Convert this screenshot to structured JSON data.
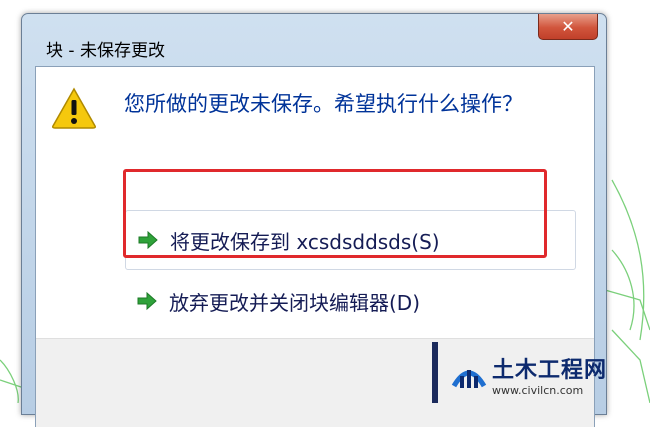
{
  "window": {
    "title": "块 - 未保存更改",
    "close_glyph": "✕"
  },
  "dialog": {
    "question": "您所做的更改未保存。希望执行什么操作？",
    "options": [
      {
        "label": "将更改保存到 xcsdsddsds(S)",
        "icon": "green-arrow-icon"
      },
      {
        "label": "放弃更改并关闭块编辑器(D)",
        "icon": "green-arrow-icon"
      }
    ]
  },
  "annotation": {
    "highlight_color": "#e0292c"
  },
  "watermark": {
    "title": "土木工程网",
    "url": "www.civilcn.com"
  },
  "colors": {
    "question_text": "#003399",
    "option_text": "#151c55",
    "arrow_green": "#2fa23a"
  }
}
